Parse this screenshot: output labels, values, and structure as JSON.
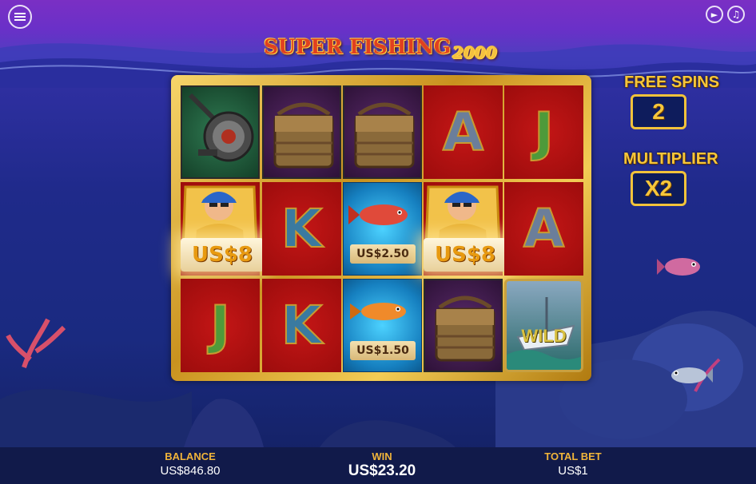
{
  "game": {
    "logo_main": "SUPER FISHING",
    "logo_year": "2000"
  },
  "header": {
    "menu_icon": "menu-icon",
    "sound_icon": "sound-icon",
    "music_icon": "music-note-icon"
  },
  "side_panel": {
    "free_spins_label": "FREE SPINS",
    "free_spins_value": "2",
    "multiplier_label": "MULTIPLIER",
    "multiplier_value": "X2"
  },
  "reels": [
    [
      "fishing-reel",
      "fisherman",
      "letter-J"
    ],
    [
      "tackle-basket",
      "letter-K",
      "letter-K"
    ],
    [
      "tackle-basket",
      "fish-red",
      "fish-orange"
    ],
    [
      "letter-A",
      "fisherman",
      "tackle-basket"
    ],
    [
      "letter-J",
      "letter-A",
      "wild"
    ]
  ],
  "symbols": {
    "fisherman_prize_1": "US$8",
    "fisherman_prize_2": "US$8",
    "fish_prize_1": "US$2.50",
    "fish_prize_2": "US$1.50",
    "wild_label": "WILD",
    "letter_J": "J",
    "letter_K": "K",
    "letter_A": "A"
  },
  "footer": {
    "balance_label": "BALANCE",
    "balance_value": "US$846.80",
    "win_label": "WIN",
    "win_value": "US$23.20",
    "total_bet_label": "TOTAL BET",
    "total_bet_value": "US$1"
  },
  "colors": {
    "gold": "#f6c63a",
    "reel_red": "#c41616",
    "reel_blue": "#4cd2ff",
    "footer_bg": "#111a4a"
  }
}
